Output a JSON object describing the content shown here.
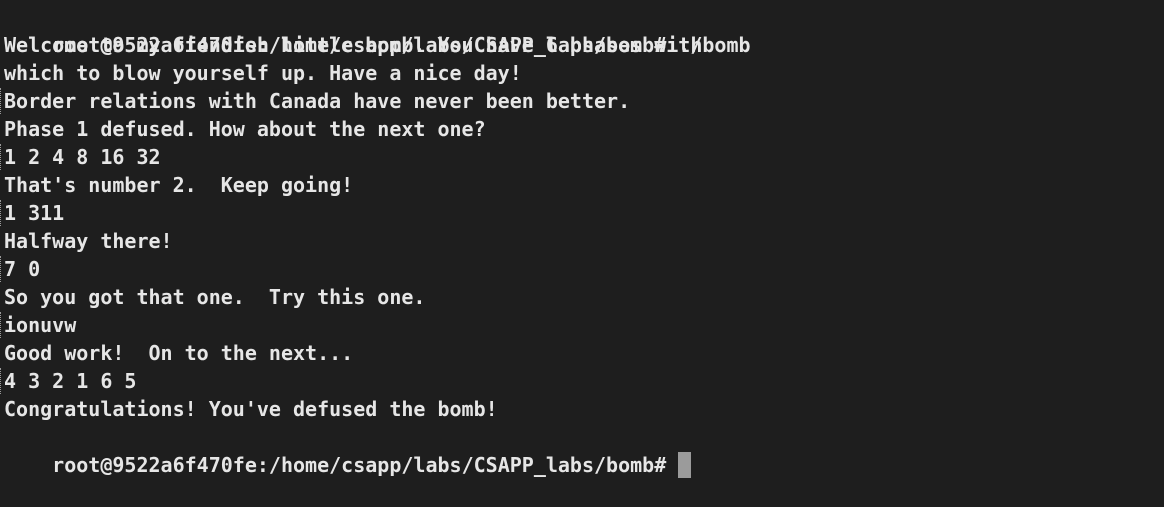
{
  "terminal": {
    "prompt": "root@9522a6f470fe:/home/csapp/labs/CSAPP_labs/bomb#",
    "command": " ./bomb",
    "lines": [
      "Welcome to my fiendish little bomb. You have 6 phases with",
      "which to blow yourself up. Have a nice day!",
      "Border relations with Canada have never been better.",
      "Phase 1 defused. How about the next one?",
      "1 2 4 8 16 32",
      "That's number 2.  Keep going!",
      "1 311",
      "Halfway there!",
      "7 0",
      "So you got that one.  Try this one.",
      "ionuvw",
      "Good work!  On to the next...",
      "4 3 2 1 6 5",
      "Congratulations! You've defused the bomb!"
    ],
    "final_prompt": "root@9522a6f470fe:/home/csapp/labs/CSAPP_labs/bomb#"
  },
  "colors": {
    "background": "#1e1e1e",
    "text": "#e6e6e6",
    "cursor": "#9b9b9b"
  }
}
